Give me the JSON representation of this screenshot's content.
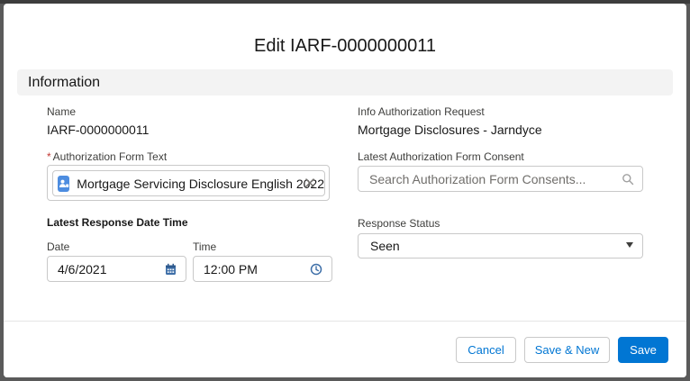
{
  "modal": {
    "title": "Edit IARF-0000000011"
  },
  "section": {
    "title": "Information"
  },
  "fields": {
    "name": {
      "label": "Name",
      "value": "IARF-0000000011"
    },
    "info_request": {
      "label": "Info Authorization Request",
      "value": "Mortgage Disclosures - Jarndyce"
    },
    "auth_form_text": {
      "required_marker": "*",
      "label": "Authorization Form Text",
      "pill_value": "Mortgage Servicing Disclosure English 2022",
      "pill_icon": "contact-icon",
      "remove_icon": "close-icon"
    },
    "latest_consent": {
      "label": "Latest Authorization Form Consent",
      "placeholder": "Search Authorization Form Consents...",
      "icon": "search-icon"
    },
    "latest_response": {
      "heading": "Latest Response Date Time",
      "date_label": "Date",
      "date_value": "4/6/2021",
      "date_icon": "calendar-icon",
      "time_label": "Time",
      "time_value": "12:00 PM",
      "time_icon": "clock-icon"
    },
    "response_status": {
      "label": "Response Status",
      "value": "Seen",
      "icon": "chevron-down-icon"
    }
  },
  "footer": {
    "cancel_label": "Cancel",
    "save_new_label": "Save & New",
    "save_label": "Save"
  },
  "colors": {
    "brand": "#0176d3",
    "required": "#c23934",
    "section_bg": "#f3f3f3"
  }
}
